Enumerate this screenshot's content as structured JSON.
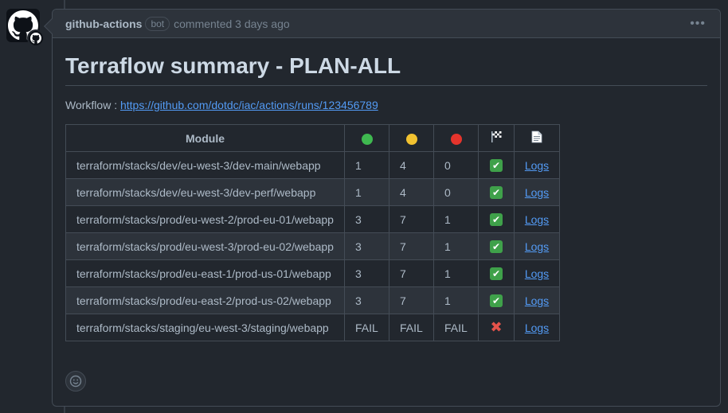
{
  "comment": {
    "author": "github-actions",
    "bot_label": "bot",
    "action": "commented 3 days ago",
    "menu_icon": "kebab-horizontal-icon"
  },
  "body": {
    "title": "Terraflow summary - PLAN-ALL",
    "workflow_label": "Workflow : ",
    "workflow_url": "https://github.com/dotdc/iac/actions/runs/123456789"
  },
  "table": {
    "headers": {
      "module": "Module",
      "add_icon": "green-circle-icon",
      "change_icon": "yellow-circle-icon",
      "destroy_icon": "red-circle-icon",
      "status_icon": "checkered-flag-icon",
      "logs_icon": "page-facing-up-icon"
    },
    "rows": [
      {
        "module": "terraform/stacks/dev/eu-west-3/dev-main/webapp",
        "add": "1",
        "change": "4",
        "destroy": "0",
        "status": "success",
        "logs": "Logs"
      },
      {
        "module": "terraform/stacks/dev/eu-west-3/dev-perf/webapp",
        "add": "1",
        "change": "4",
        "destroy": "0",
        "status": "success",
        "logs": "Logs"
      },
      {
        "module": "terraform/stacks/prod/eu-west-2/prod-eu-01/webapp",
        "add": "3",
        "change": "7",
        "destroy": "1",
        "status": "success",
        "logs": "Logs"
      },
      {
        "module": "terraform/stacks/prod/eu-west-3/prod-eu-02/webapp",
        "add": "3",
        "change": "7",
        "destroy": "1",
        "status": "success",
        "logs": "Logs"
      },
      {
        "module": "terraform/stacks/prod/eu-east-1/prod-us-01/webapp",
        "add": "3",
        "change": "7",
        "destroy": "1",
        "status": "success",
        "logs": "Logs"
      },
      {
        "module": "terraform/stacks/prod/eu-east-2/prod-us-02/webapp",
        "add": "3",
        "change": "7",
        "destroy": "1",
        "status": "success",
        "logs": "Logs"
      },
      {
        "module": "terraform/stacks/staging/eu-west-3/staging/webapp",
        "add": "FAIL",
        "change": "FAIL",
        "destroy": "FAIL",
        "status": "failure",
        "logs": "Logs"
      }
    ]
  },
  "colors": {
    "green": "#3fb950",
    "yellow": "#f2c230",
    "red": "#e5342c"
  },
  "reaction_icon": "smiley-icon"
}
